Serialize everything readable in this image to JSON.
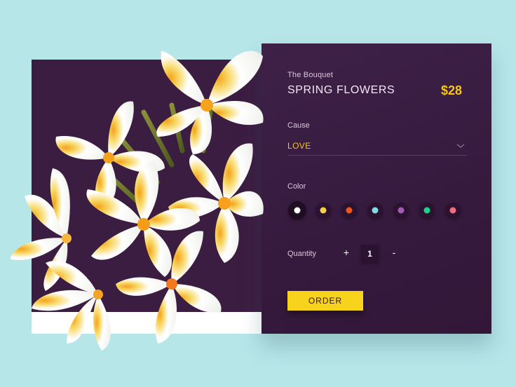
{
  "product": {
    "subtitle": "The Bouquet",
    "title": "SPRING FLOWERS",
    "price": "$28"
  },
  "cause": {
    "label": "Cause",
    "value": "LOVE"
  },
  "color": {
    "label": "Color",
    "swatches": [
      "#ffffff",
      "#f4cf4a",
      "#f0561c",
      "#7fdde5",
      "#a25bb7",
      "#19d38a",
      "#ef6d80"
    ],
    "selected_index": 0
  },
  "quantity": {
    "label": "Quantity",
    "increment": "+",
    "value": "1",
    "decrement": "-"
  },
  "order_button": "ORDER",
  "colors": {
    "background": "#b7e6e9",
    "card": "#3c1d42",
    "accent": "#f5c518"
  }
}
